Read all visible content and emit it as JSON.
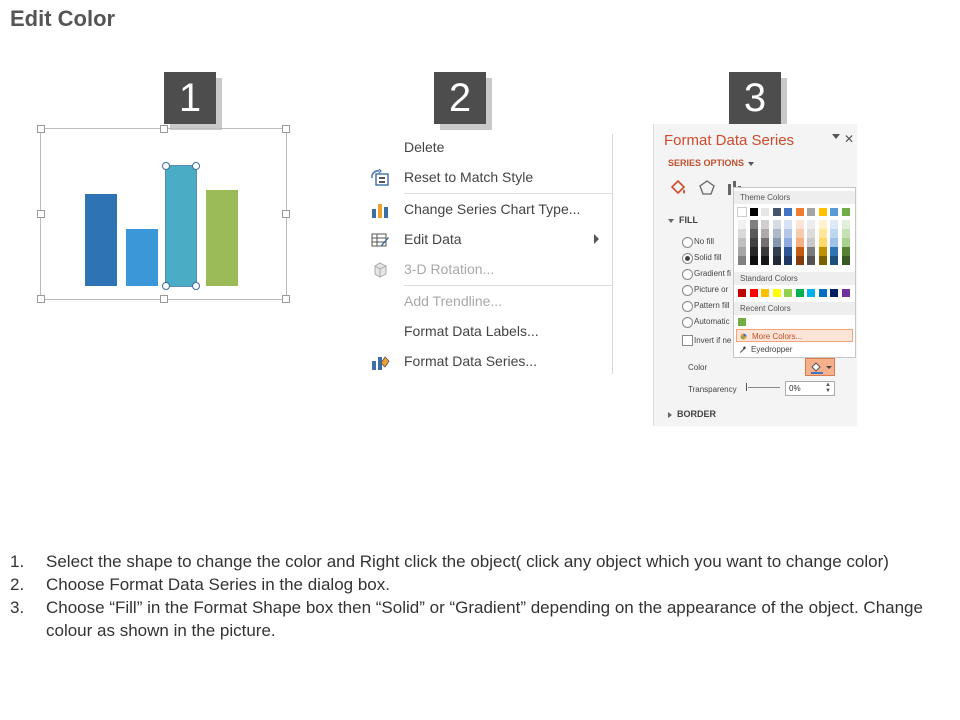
{
  "title": "Edit Color",
  "badges": [
    "1",
    "2",
    "3"
  ],
  "chart": {
    "bars": [
      {
        "value": 92,
        "color": "#2e74b5",
        "selected": false
      },
      {
        "value": 57,
        "color": "#3b97d8",
        "selected": false
      },
      {
        "value": 120,
        "color": "#4bacc6",
        "selected": true
      },
      {
        "value": 96,
        "color": "#9bbb59",
        "selected": false
      }
    ]
  },
  "context_menu": {
    "items": [
      {
        "label": "Delete",
        "icon": "none",
        "disabled": false
      },
      {
        "label": "Reset to Match Style",
        "icon": "reset-style-icon",
        "disabled": false
      },
      {
        "label": "Change Series Chart Type...",
        "icon": "bar-chart-icon",
        "disabled": false
      },
      {
        "label": "Edit Data",
        "icon": "table-edit-icon",
        "disabled": false,
        "submenu": true
      },
      {
        "label": "3-D Rotation...",
        "icon": "cube-icon",
        "disabled": true
      },
      {
        "label": "Add Trendline...",
        "icon": "none",
        "disabled": true
      },
      {
        "label": "Format Data Labels...",
        "icon": "none",
        "disabled": false
      },
      {
        "label": "Format Data Series...",
        "icon": "paint-bucket-chart-icon",
        "disabled": false
      }
    ]
  },
  "format_pane": {
    "title": "Format Data Series",
    "series_options": "SERIES OPTIONS",
    "fill_section": "FILL",
    "fill_options": [
      "No fill",
      "Solid fill",
      "Gradient fi",
      "Picture or",
      "Pattern fill",
      "Automatic"
    ],
    "invert_label": "Invert if ne",
    "color_label": "Color",
    "transparency_label": "Transparency",
    "transparency_value": "0%",
    "border_section": "BORDER",
    "accent": "#d04a2b"
  },
  "color_popup": {
    "theme_header": "Theme Colors",
    "standard_header": "Standard Colors",
    "recent_header": "Recent Colors",
    "theme_top": [
      "#ffffff",
      "#000000",
      "#e7e6e6",
      "#44546a",
      "#4472c4",
      "#ed7d31",
      "#a5a5a5",
      "#ffc000",
      "#5b9bd5",
      "#70ad47"
    ],
    "theme_shades": [
      [
        "#f2f2f2",
        "#d9d9d9",
        "#bfbfbf",
        "#a6a6a6",
        "#808080"
      ],
      [
        "#808080",
        "#595959",
        "#404040",
        "#262626",
        "#0d0d0d"
      ],
      [
        "#d0cece",
        "#aeaaaa",
        "#757070",
        "#3a3838",
        "#171616"
      ],
      [
        "#d6dce4",
        "#adb9ca",
        "#8496b0",
        "#333f4f",
        "#222a35"
      ],
      [
        "#d9e2f3",
        "#b4c7e7",
        "#8faadc",
        "#2f5597",
        "#1f3864"
      ],
      [
        "#fbe5d6",
        "#f8cbad",
        "#f4b183",
        "#c55a11",
        "#843c0c"
      ],
      [
        "#ededed",
        "#dbdbdb",
        "#c9c9c9",
        "#7b7b7b",
        "#525252"
      ],
      [
        "#fff2cc",
        "#ffe699",
        "#ffd966",
        "#bf9000",
        "#7f6000"
      ],
      [
        "#deebf7",
        "#bdd7ee",
        "#9dc3e6",
        "#2e75b6",
        "#1f4e79"
      ],
      [
        "#e2f0d9",
        "#c5e0b4",
        "#a9d18e",
        "#548235",
        "#385723"
      ]
    ],
    "standard": [
      "#c00000",
      "#ff0000",
      "#ffc000",
      "#ffff00",
      "#92d050",
      "#00b050",
      "#00b0f0",
      "#0070c0",
      "#002060",
      "#7030a0"
    ],
    "recent": [
      "#70ad47"
    ],
    "more_colors": "More Colors...",
    "eyedropper": "Eyedropper"
  },
  "instructions": [
    {
      "num": "1.",
      "text": "Select the shape to change the color and Right click the object( click any object which you want to change color)"
    },
    {
      "num": "2.",
      "text": "Choose Format Data Series in the dialog box."
    },
    {
      "num": "3.",
      "text": "Choose “Fill” in the Format Shape box then “Solid” or “Gradient” depending on the appearance of the object. Change colour as shown in the picture."
    }
  ]
}
